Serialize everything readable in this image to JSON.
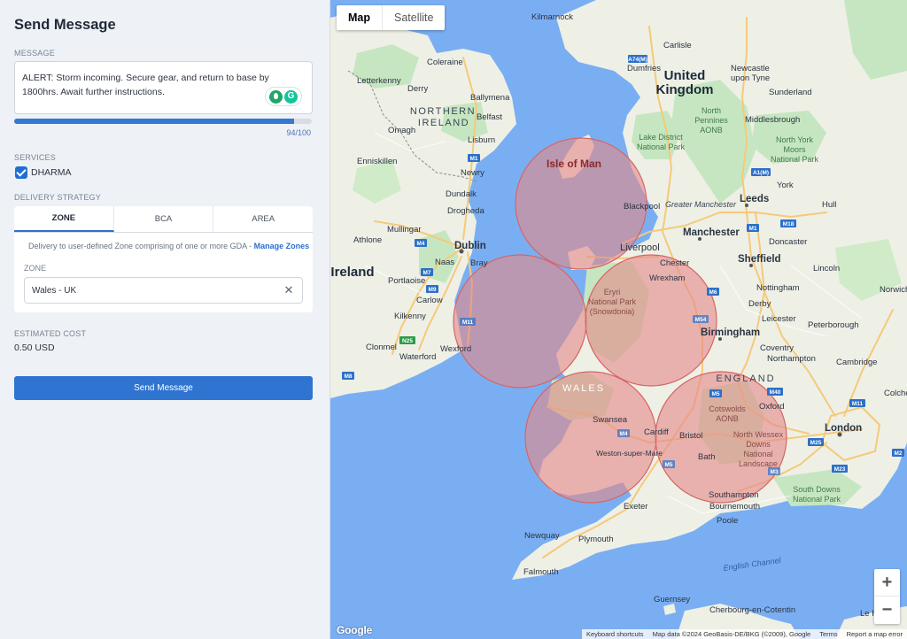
{
  "panel": {
    "title": "Send Message",
    "message": {
      "label": "MESSAGE",
      "text": "ALERT: Storm incoming. Secure gear, and return to base by 1800hrs. Await further instructions.",
      "grammar_icon_letter": "G",
      "char_count": "94/100",
      "fill_fraction": 0.94
    },
    "services": {
      "label": "SERVICES",
      "items": [
        {
          "label": "DHARMA",
          "checked": true
        }
      ]
    },
    "delivery": {
      "label": "DELIVERY STRATEGY",
      "tabs": [
        {
          "label": "ZONE",
          "active": true
        },
        {
          "label": "BCA",
          "active": false
        },
        {
          "label": "AREA",
          "active": false
        }
      ],
      "note": "Delivery to user-defined Zone comprising of one or more GDA - ",
      "note_link": "Manage Zones",
      "zone_label": "ZONE",
      "zone_value": "Wales - UK",
      "clear_glyph": "✕"
    },
    "cost": {
      "label": "ESTIMATED COST",
      "value": "0.50 USD"
    },
    "send_label": "Send Message"
  },
  "map": {
    "types": [
      {
        "label": "Map",
        "active": true
      },
      {
        "label": "Satellite",
        "active": false
      }
    ],
    "zoom_in": "+",
    "zoom_out": "−",
    "logo": "Google",
    "attribution": [
      "Keyboard shortcuts",
      "Map data ©2024 GeoBasis-DE/BKG (©2009), Google",
      "Terms",
      "Report a map error"
    ],
    "colors": {
      "water": "#7aaef2",
      "land": "#eef0e6",
      "green": "#bfe3bf",
      "zone_fill": "#e38a8a",
      "zone_stroke": "#d66565",
      "motorway": "#f6c97a"
    },
    "labels": {
      "uk": "United",
      "uk2": "Kingdom",
      "ni": "NORTHERN",
      "ni2": "IRELAND",
      "ireland": "Ireland",
      "wales": "WALES",
      "england": "ENGLAND",
      "iom": "Isle of Man",
      "kilmarnock": "Kilmarnock",
      "dumfries": "Dumfries",
      "coleraine": "Coleraine",
      "letterkenny": "Letterkenny",
      "derry": "Derry",
      "ballymena": "Ballymena",
      "belfast": "Belfast",
      "lisburn": "Lisburn",
      "omagh": "Omagh",
      "enniskillen": "Enniskillen",
      "newry": "Newry",
      "dundalk": "Dundalk",
      "drogheda": "Drogheda",
      "dublin": "Dublin",
      "naas": "Naas",
      "bray": "Bray",
      "mullingar": "Mullingar",
      "athlone": "Athlone",
      "portlaoise": "Portlaoise",
      "carlow": "Carlow",
      "kilkenny": "Kilkenny",
      "clonmel": "Clonmel",
      "waterford": "Waterford",
      "wexford": "Wexford",
      "carlisle": "Carlisle",
      "newcastle": "Newcastle",
      "newcastle2": "upon Tyne",
      "sunderland": "Sunderland",
      "middlesbrough": "Middlesbrough",
      "np1": "North",
      "np2": "Pennines",
      "np3": "AONB",
      "ld1": "Lake District",
      "ld2": "National Park",
      "nym1": "North York",
      "nym2": "Moors",
      "nym3": "National Park",
      "york": "York",
      "leeds": "Leeds",
      "hull": "Hull",
      "blackpool": "Blackpool",
      "gb1": "Greater Manchester",
      "manchester": "Manchester",
      "liverpool": "Liverpool",
      "sheffield": "Sheffield",
      "doncaster": "Doncaster",
      "chester": "Chester",
      "wrexham": "Wrexham",
      "eryri1": "Eryri",
      "eryri2": "National Park",
      "eryri3": "(Snowdonia)",
      "nottingham": "Nottingham",
      "derby": "Derby",
      "lincoln": "Lincoln",
      "leicester": "Leicester",
      "peterborough": "Peterborough",
      "birmingham": "Birmingham",
      "coventry": "Coventry",
      "northampton": "Northampton",
      "cambridge": "Cambridge",
      "norwich": "Norwich",
      "swansea": "Swansea",
      "cardiff": "Cardiff",
      "bristol": "Bristol",
      "bath": "Bath",
      "wsm": "Weston-super-Mare",
      "oxford": "Oxford",
      "london": "London",
      "colchester": "Colchester",
      "cots1": "Cotswolds",
      "cots2": "AONB",
      "nwd1": "North Wessex",
      "nwd2": "Downs",
      "nwd3": "National",
      "nwd4": "Landscape",
      "southampton": "Southampton",
      "bournemouth": "Bournemouth",
      "poole": "Poole",
      "exeter": "Exeter",
      "plymouth": "Plymouth",
      "newquay": "Newquay",
      "falmouth": "Falmouth",
      "sd1": "South Downs",
      "sd2": "National Park",
      "channel": "English Channel",
      "cherbourg": "Cherbourg-en-Cotentin",
      "guernsey": "Guernsey",
      "lehavre": "Le Havre"
    },
    "road_badges": {
      "a74": "A74(M)",
      "a1m": "A1(M)",
      "m1a": "M1",
      "m18": "M18",
      "m6": "M6",
      "m5": "M5",
      "m4": "M4",
      "m54": "M54",
      "m40": "M40",
      "m11": "M11",
      "m25": "M25",
      "m23": "M23",
      "m3": "M3",
      "m2": "M2",
      "m1i": "M1",
      "m4i": "M4",
      "m7": "M7",
      "m9": "M9",
      "m8": "M8",
      "m11i": "M11",
      "n25": "N25",
      "m4w": "M4",
      "m5w": "M5"
    }
  }
}
